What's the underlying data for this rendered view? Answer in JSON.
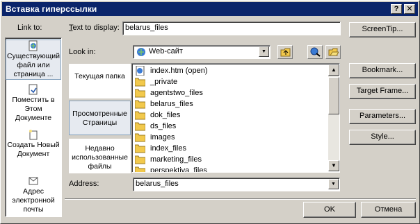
{
  "window": {
    "title": "Вставка гиперссылки"
  },
  "titlebar_buttons": {
    "help": "?",
    "close": "✕"
  },
  "link_to": {
    "label": "Link to:",
    "items": [
      {
        "label": "Существующий файл или страница ...",
        "icon": "existing-page-icon"
      },
      {
        "label": "Поместить в Этом Документе",
        "icon": "place-in-document-icon"
      },
      {
        "label": "Создать Новый Документ",
        "icon": "new-document-icon"
      },
      {
        "label": "Адрес электронной почты",
        "icon": "email-icon"
      }
    ]
  },
  "text_to_display": {
    "label": "Text to display:",
    "value": "belarus_files"
  },
  "screentip_button": "ScreenTip...",
  "look_in": {
    "label": "Look in:",
    "value": "Web-сайт"
  },
  "tabs": [
    {
      "label": "Текущая папка"
    },
    {
      "label": "Просмотренные Страницы"
    },
    {
      "label": "Недавно использованные файлы"
    }
  ],
  "files": [
    {
      "name": "index.htm (open)",
      "icon": "html-file-icon"
    },
    {
      "name": "_private",
      "icon": "folder-icon"
    },
    {
      "name": "agentstwo_files",
      "icon": "folder-icon"
    },
    {
      "name": "belarus_files",
      "icon": "folder-icon"
    },
    {
      "name": "dok_files",
      "icon": "folder-icon"
    },
    {
      "name": "ds_files",
      "icon": "folder-icon"
    },
    {
      "name": "images",
      "icon": "folder-icon"
    },
    {
      "name": "index_files",
      "icon": "folder-icon"
    },
    {
      "name": "marketing_files",
      "icon": "folder-icon"
    },
    {
      "name": "perspektiva_files",
      "icon": "folder-icon"
    }
  ],
  "right_buttons": {
    "bookmark": "Bookmark...",
    "target_frame": "Target Frame...",
    "parameters": "Parameters...",
    "style": "Style..."
  },
  "address": {
    "label": "Address:",
    "value": "belarus_files"
  },
  "ok_button": "OK",
  "cancel_button": "Отмена",
  "colors": {
    "titlebar": "#0a246a",
    "face": "#d4d0c8",
    "selected": "#e6eaf0",
    "folder": "#f2c94c"
  }
}
